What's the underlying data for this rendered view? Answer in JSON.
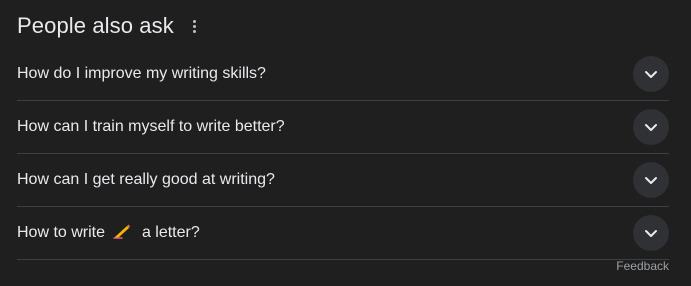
{
  "header": {
    "title": "People also ask",
    "more_icon": "more-vert-icon"
  },
  "questions": [
    {
      "text": "How do I improve my writing skills?"
    },
    {
      "text": "How can I train myself to write better?"
    },
    {
      "text": "How can I get really good at writing?"
    },
    {
      "text_before": "How to write",
      "emoji": "writing-hand-emoji",
      "text_after": "a letter?"
    }
  ],
  "expand_icon": "chevron-down-icon",
  "feedback_label": "Feedback",
  "colors": {
    "background": "#1f1f1f",
    "divider": "#3c4043",
    "chevron_bg": "#303134",
    "text": "#e8eaed",
    "muted": "#9aa0a6"
  }
}
